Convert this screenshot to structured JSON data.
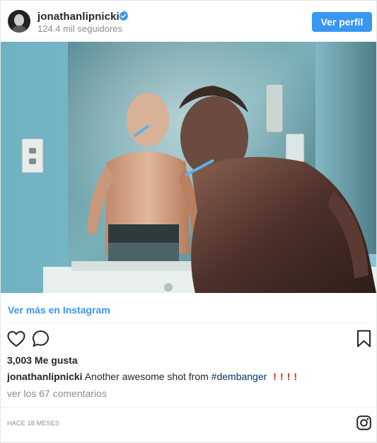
{
  "header": {
    "username": "jonathanlipnicki",
    "followers": "124.4 mil seguidores",
    "follow_button": "Ver perfil"
  },
  "post": {
    "view_more": "Ver más en Instagram",
    "likes": "3,003 Me gusta",
    "caption_user": "jonathanlipnicki",
    "caption_text": " Another awesome shot from ",
    "hashtag": "#dembanger",
    "comments_link": "ver los 67 comentarios",
    "timestamp": "HACE 18 MESES"
  },
  "icons": {
    "avatar": "profile-photo",
    "verified": "verified-badge-icon",
    "like": "heart-icon",
    "comment": "comment-bubble-icon",
    "save": "bookmark-icon",
    "brand": "instagram-icon",
    "emphasis": "red-exclamation-mark-emoji"
  },
  "colors": {
    "accent": "#3897f0",
    "hashtag": "#003569",
    "muted": "#8e8e8e",
    "text": "#262626"
  }
}
